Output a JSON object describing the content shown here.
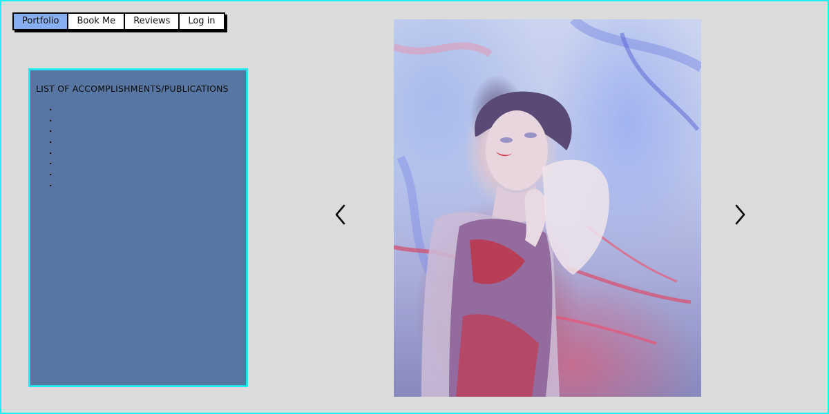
{
  "nav": {
    "items": [
      {
        "label": "Portfolio",
        "active": true
      },
      {
        "label": "Book Me",
        "active": false
      },
      {
        "label": "Reviews",
        "active": false
      },
      {
        "label": "Log in",
        "active": false
      }
    ]
  },
  "panel": {
    "title": "LIST OF ACCOMPLISHMENTS/PUBLICATIONS",
    "items": [
      "",
      "",
      "",
      "",
      "",
      "",
      "",
      ""
    ]
  },
  "carousel": {
    "prev_icon": "chevron-left-icon",
    "next_icon": "chevron-right-icon"
  },
  "colors": {
    "frame_border": "#19f0f0",
    "background": "#dcdcdc",
    "panel_bg": "#5777a2",
    "nav_active": "#88aef2"
  }
}
